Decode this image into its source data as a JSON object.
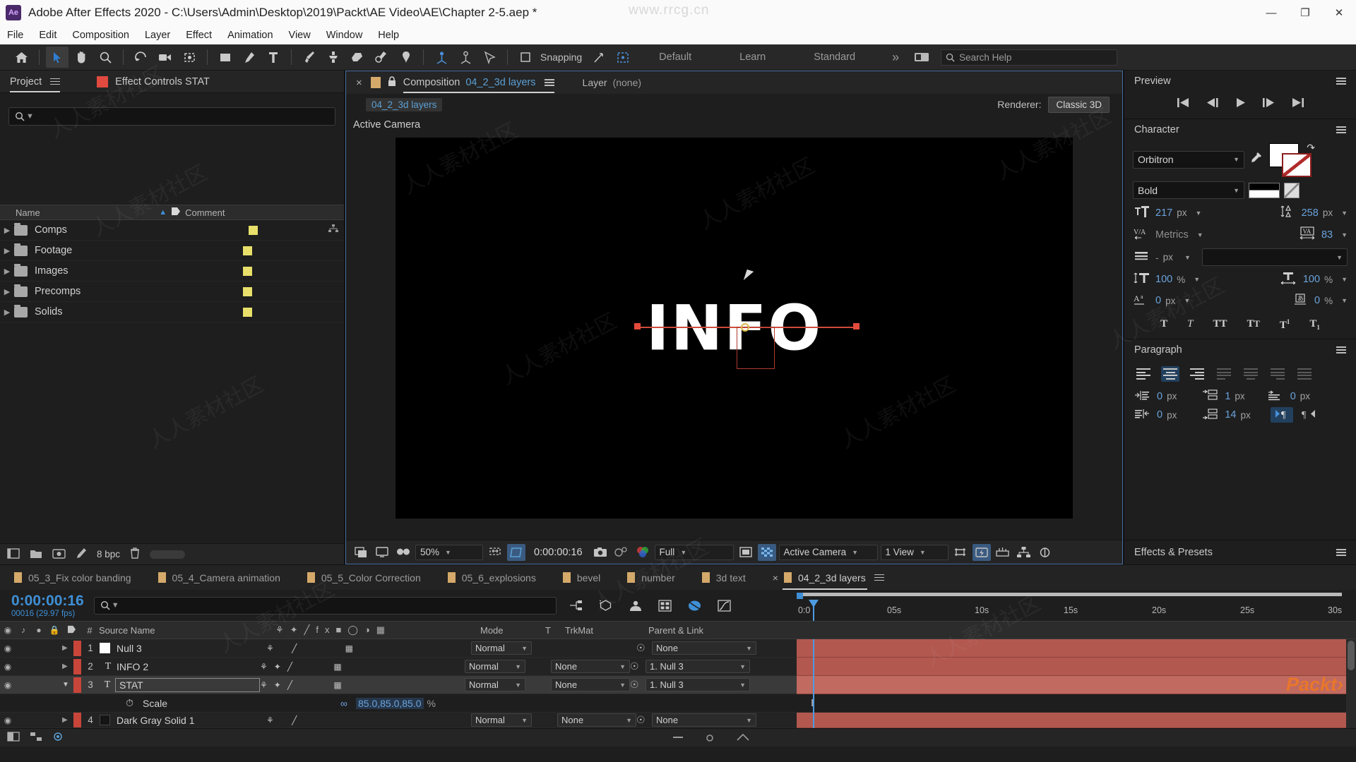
{
  "titlebar": {
    "app_icon": "Ae",
    "title": "Adobe After Effects 2020 - C:\\Users\\Admin\\Desktop\\2019\\Packt\\AE Video\\AE\\Chapter 2-5.aep *",
    "watermark": "www.rrcg.cn",
    "minimize": "—",
    "maximize": "❐",
    "close": "✕"
  },
  "menubar": {
    "items": [
      "File",
      "Edit",
      "Composition",
      "Layer",
      "Effect",
      "Animation",
      "View",
      "Window",
      "Help"
    ]
  },
  "toolbar": {
    "snapping_label": "Snapping",
    "workspaces": [
      "Default",
      "Learn",
      "Standard"
    ],
    "overflow": "»",
    "search_help_placeholder": "Search Help",
    "tools": [
      "home-icon",
      "selection-tool",
      "hand-tool",
      "zoom-tool",
      "rotation-tool",
      "camera-tool",
      "pan-behind-tool",
      "shape-tool",
      "pen-tool",
      "type-tool",
      "brush-tool",
      "clone-stamp-tool",
      "eraser-tool",
      "roto-brush-tool",
      "puppet-tool",
      "local-axis-mode",
      "world-axis-mode",
      "view-axis-mode",
      "grid-guides",
      "3d-view-shortcut"
    ]
  },
  "project_panel": {
    "tab_project": "Project",
    "tab_effect_controls": "Effect Controls  STAT",
    "effect_swatch_color": "#e04a3f",
    "search_placeholder": "",
    "columns": [
      "Name",
      "Comment"
    ],
    "items": [
      {
        "name": "Comps",
        "label_color": "#e8e06a"
      },
      {
        "name": "Footage",
        "label_color": "#e8e06a"
      },
      {
        "name": "Images",
        "label_color": "#e8e06a"
      },
      {
        "name": "Precomps",
        "label_color": "#e8e06a"
      },
      {
        "name": "Solids",
        "label_color": "#e8e06a"
      }
    ],
    "bit_depth": "8 bpc"
  },
  "composition_panel": {
    "close_x": "×",
    "type_label": "Composition",
    "comp_name": "04_2_3d layers",
    "layer_label": "Layer",
    "layer_value": "(none)",
    "comp_chip": "04_2_3d layers",
    "renderer_label": "Renderer:",
    "renderer_value": "Classic 3D",
    "view_label": "Active Camera",
    "canvas_text": "INFO",
    "viewer_toolbar": {
      "zoom": "50%",
      "timecode": "0:00:00:16",
      "resolution": "Full",
      "camera": "Active Camera",
      "views": "1 View"
    }
  },
  "preview_panel": {
    "title": "Preview",
    "buttons": [
      "first-frame",
      "previous-frame",
      "play",
      "next-frame",
      "last-frame"
    ]
  },
  "character_panel": {
    "title": "Character",
    "font_family": "Orbitron",
    "font_style": "Bold",
    "font_size": "217",
    "font_size_unit": "px",
    "leading": "258",
    "leading_unit": "px",
    "kerning": "Metrics",
    "tracking": "83",
    "stroke_width": "-",
    "stroke_width_unit": "px",
    "stroke_type": "",
    "vertical_scale": "100",
    "vertical_scale_unit": "%",
    "horizontal_scale": "100",
    "horizontal_scale_unit": "%",
    "baseline_shift": "0",
    "baseline_shift_unit": "px",
    "tsume": "0",
    "tsume_unit": "%",
    "styles": [
      "Faux Bold",
      "Faux Italic",
      "All Caps",
      "Small Caps",
      "Superscript",
      "Subscript"
    ]
  },
  "paragraph_panel": {
    "title": "Paragraph",
    "indent_left": "0",
    "space_before": "1",
    "indent_right_top": "0",
    "indent_first_line": "0",
    "space_after": "14",
    "unit": "px"
  },
  "effects_presets_panel": {
    "title": "Effects & Presets"
  },
  "timeline": {
    "tabs": [
      {
        "label": "05_3_Fix color banding",
        "active": false
      },
      {
        "label": "05_4_Camera animation",
        "active": false
      },
      {
        "label": "05_5_Color Correction",
        "active": false
      },
      {
        "label": "05_6_explosions",
        "active": false
      },
      {
        "label": "bevel",
        "active": false
      },
      {
        "label": "number",
        "active": false
      },
      {
        "label": "3d text",
        "active": false
      },
      {
        "label": "04_2_3d layers",
        "active": true
      }
    ],
    "current_time": "0:00:00:16",
    "frame_info": "00016 (29.97 fps)",
    "search_placeholder": "",
    "ruler_labels": [
      "0:0",
      "05s",
      "10s",
      "15s",
      "20s",
      "25s",
      "30s"
    ],
    "columns": [
      "#",
      "Source Name",
      "Mode",
      "T",
      "TrkMat",
      "Parent & Link"
    ],
    "layers": [
      {
        "num": "1",
        "name": "Null 3",
        "type": "solid",
        "swatch": "#ffffff",
        "mode": "Normal",
        "trkmat": "",
        "parent": "None",
        "selected": false
      },
      {
        "num": "2",
        "name": "INFO 2",
        "type": "text",
        "swatch": "",
        "mode": "Normal",
        "trkmat": "None",
        "parent": "1. Null 3",
        "selected": false
      },
      {
        "num": "3",
        "name": "STAT",
        "type": "text",
        "swatch": "",
        "mode": "Normal",
        "trkmat": "None",
        "parent": "1. Null 3",
        "selected": true
      },
      {
        "num": "4",
        "name": "Dark Gray Solid 1",
        "type": "solid",
        "swatch": "#151515",
        "mode": "Normal",
        "trkmat": "None",
        "parent": "None",
        "selected": false
      }
    ],
    "property_row": {
      "name": "Scale",
      "value": "85.0,85.0,85.0",
      "unit": "%"
    }
  },
  "branding": {
    "packt": "Packt",
    "packt_suffix": "›"
  },
  "watermarks": [
    "人人素材社区",
    "人人素材社区",
    "人人素材社区",
    "人人素材社区",
    "人人素材社区",
    "人人素材社区",
    "人人素材社区",
    "人人素材社区",
    "人人素材社区",
    "人人素材社区",
    "人人素材社区",
    "人人素材社区"
  ]
}
